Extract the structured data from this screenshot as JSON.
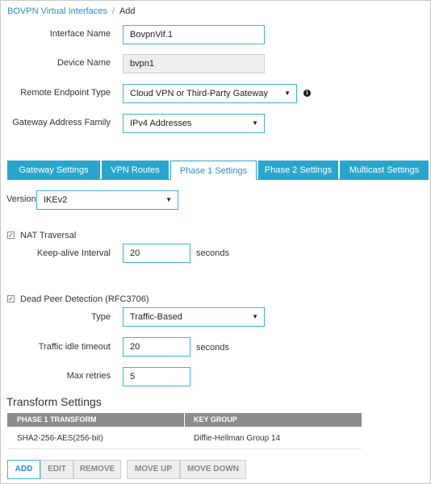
{
  "breadcrumb": {
    "parent": "BOVPN Virtual Interfaces",
    "separator": "/",
    "current": "Add"
  },
  "form": {
    "interface_name_label": "Interface Name",
    "interface_name_value": "BovpnVif.1",
    "device_name_label": "Device Name",
    "device_name_value": "bvpn1",
    "remote_endpoint_label": "Remote Endpoint Type",
    "remote_endpoint_value": "Cloud VPN or Third-Party Gateway",
    "gateway_family_label": "Gateway Address Family",
    "gateway_family_value": "IPv4 Addresses"
  },
  "tabs": [
    {
      "label": "Gateway Settings"
    },
    {
      "label": "VPN Routes"
    },
    {
      "label": "Phase 1 Settings"
    },
    {
      "label": "Phase 2 Settings"
    },
    {
      "label": "Multicast Settings"
    }
  ],
  "phase1": {
    "version_label": "Version",
    "version_value": "IKEv2",
    "nat_traversal_label": "NAT Traversal",
    "keepalive_label": "Keep-alive Interval",
    "keepalive_value": "20",
    "keepalive_unit": "seconds",
    "dpd_label": "Dead Peer Detection (RFC3706)",
    "type_label": "Type",
    "type_value": "Traffic-Based",
    "idle_timeout_label": "Traffic idle timeout",
    "idle_timeout_value": "20",
    "idle_timeout_unit": "seconds",
    "max_retries_label": "Max retries",
    "max_retries_value": "5"
  },
  "transform": {
    "title": "Transform Settings",
    "columns": [
      "PHASE 1 TRANSFORM",
      "KEY GROUP"
    ],
    "rows": [
      [
        "SHA2-256-AES(256-bit)",
        "Diffie-Hellman Group 14"
      ]
    ]
  },
  "buttons": {
    "add": "ADD",
    "edit": "EDIT",
    "remove": "REMOVE",
    "move_up": "MOVE UP",
    "move_down": "MOVE DOWN"
  },
  "icons": {
    "info": "info-icon",
    "checkmark": "checkmark-icon",
    "caret": "chevron-down-icon"
  },
  "colors": {
    "accent": "#29a6cd",
    "link": "#2a8cc7",
    "table_header": "#8c8c8c"
  }
}
